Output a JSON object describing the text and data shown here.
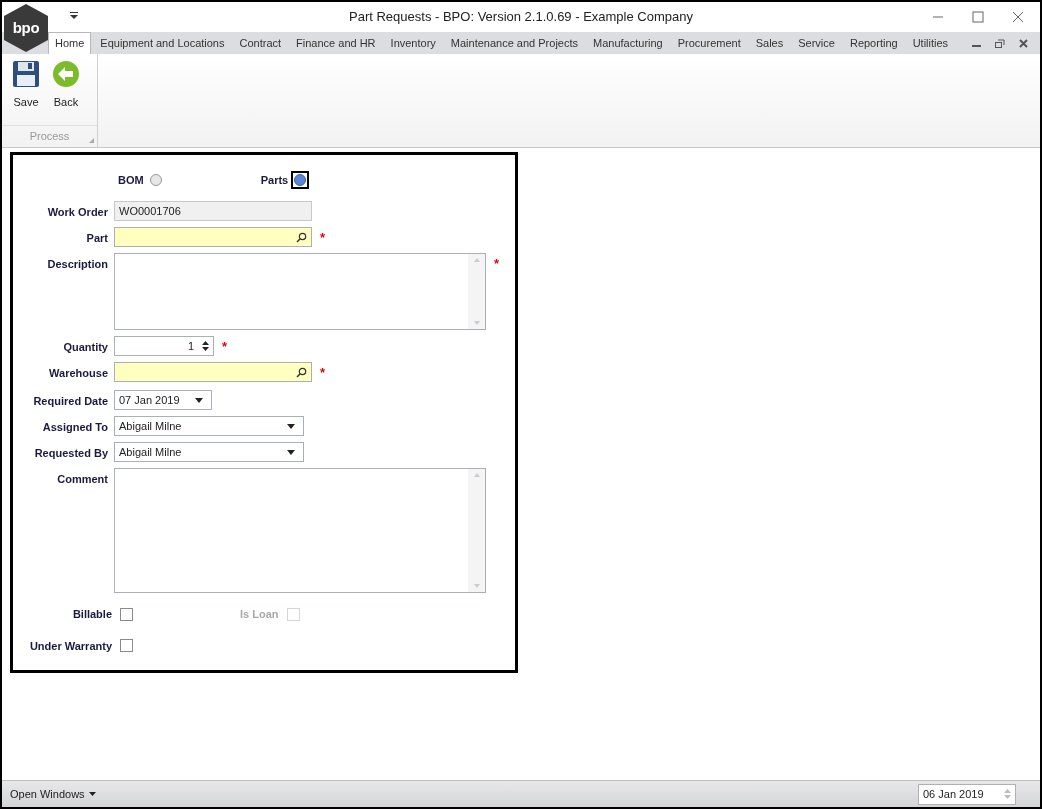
{
  "window": {
    "title": "Part Requests - BPO: Version 2.1.0.69 - Example Company",
    "logo": "bpo"
  },
  "ribbon_tabs": [
    {
      "label": "Home",
      "selected": true
    },
    {
      "label": "Equipment and Locations",
      "selected": false
    },
    {
      "label": "Contract",
      "selected": false
    },
    {
      "label": "Finance and HR",
      "selected": false
    },
    {
      "label": "Inventory",
      "selected": false
    },
    {
      "label": "Maintenance and Projects",
      "selected": false
    },
    {
      "label": "Manufacturing",
      "selected": false
    },
    {
      "label": "Procurement",
      "selected": false
    },
    {
      "label": "Sales",
      "selected": false
    },
    {
      "label": "Service",
      "selected": false
    },
    {
      "label": "Reporting",
      "selected": false
    },
    {
      "label": "Utilities",
      "selected": false
    }
  ],
  "ribbon": {
    "buttons": [
      {
        "label": "Save",
        "kind": "save"
      },
      {
        "label": "Back",
        "kind": "back"
      }
    ],
    "group": "Process"
  },
  "form": {
    "mode": [
      {
        "label": "BOM",
        "selected": false
      },
      {
        "label": "Parts",
        "selected": true
      }
    ],
    "fields": [
      {
        "label": "Work Order",
        "kind": "readonly",
        "value": "WO0001706"
      },
      {
        "label": "Part",
        "kind": "lookup",
        "required_mark": "*"
      },
      {
        "label": "Description",
        "kind": "memo",
        "required_mark": "*"
      },
      {
        "label": "Quantity",
        "kind": "spin",
        "value": "1",
        "required_mark": "*"
      },
      {
        "label": "Warehouse",
        "kind": "lookup",
        "required_mark": "*"
      },
      {
        "label": "Required Date",
        "kind": "date",
        "value": "07 Jan 2019"
      },
      {
        "label": "Assigned To",
        "kind": "combo",
        "value": "Abigail Milne"
      },
      {
        "label": "Requested By",
        "kind": "combo",
        "value": "Abigail Milne"
      },
      {
        "label": "Comment",
        "kind": "notes"
      }
    ],
    "checkbox_rows": [
      [
        {
          "label": "Billable",
          "checked": false,
          "disabled": false
        },
        {
          "label": "Is Loan",
          "checked": false,
          "disabled": true
        }
      ],
      [
        {
          "label": "Under Warranty",
          "checked": false,
          "disabled": false
        }
      ]
    ]
  },
  "status_bar": {
    "open_windows": "Open Windows",
    "date": "06 Jan 2019"
  }
}
